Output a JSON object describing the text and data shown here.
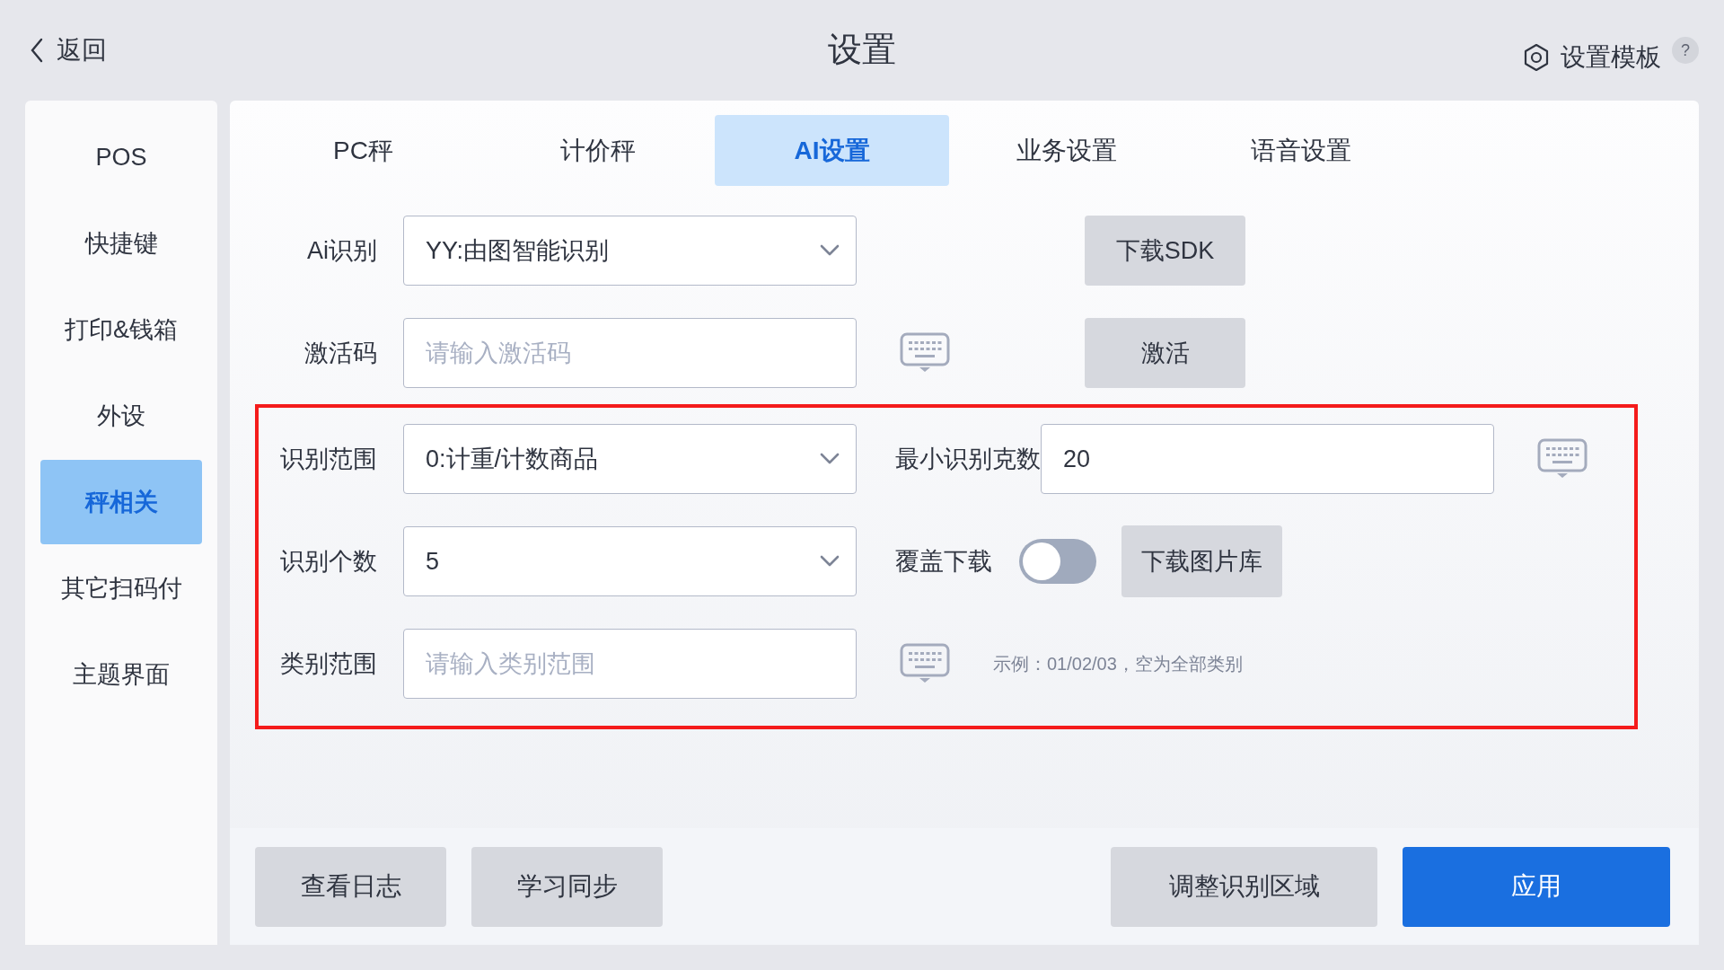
{
  "header": {
    "back_label": "返回",
    "title": "设置",
    "template_label": "设置模板",
    "help": "?"
  },
  "sidebar": {
    "items": [
      {
        "label": "POS",
        "selected": false
      },
      {
        "label": "快捷键",
        "selected": false
      },
      {
        "label": "打印&钱箱",
        "selected": false
      },
      {
        "label": "外设",
        "selected": false
      },
      {
        "label": "秤相关",
        "selected": true
      },
      {
        "label": "其它扫码付",
        "selected": false
      },
      {
        "label": "主题界面",
        "selected": false
      }
    ]
  },
  "tabs": [
    {
      "label": "PC秤",
      "selected": false
    },
    {
      "label": "计价秤",
      "selected": false
    },
    {
      "label": "AI设置",
      "selected": true
    },
    {
      "label": "业务设置",
      "selected": false
    },
    {
      "label": "语音设置",
      "selected": false
    }
  ],
  "ai_recognition": {
    "label": "Ai识别",
    "value": "YY:由图智能识别",
    "button": "下载SDK"
  },
  "activation": {
    "label": "激活码",
    "placeholder": "请输入激活码",
    "button": "激活"
  },
  "recognition_section": {
    "highlighted": true,
    "range": {
      "label": "识别范围",
      "value": "0:计重/计数商品"
    },
    "min_grams": {
      "label": "最小识别克数",
      "value": "20"
    },
    "count": {
      "label": "识别个数",
      "value": "5"
    },
    "overwrite": {
      "label": "覆盖下载",
      "on": false
    },
    "gallery_button": "下载图片库",
    "category": {
      "label": "类别范围",
      "placeholder": "请输入类别范围",
      "hint": "示例：01/02/03，空为全部类别"
    }
  },
  "footer_buttons": [
    {
      "label": "查看日志",
      "kind": "secondary"
    },
    {
      "label": "学习同步",
      "kind": "secondary"
    },
    {
      "label": "调整识别区域",
      "kind": "secondary"
    },
    {
      "label": "应用",
      "kind": "primary"
    }
  ]
}
